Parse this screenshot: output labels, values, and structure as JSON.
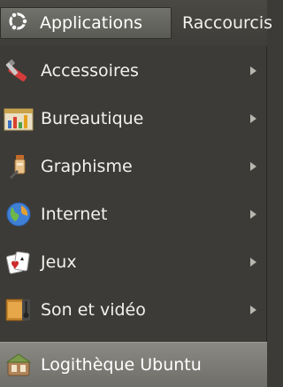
{
  "panel": {
    "applications_label": "Applications",
    "raccourcis_label": "Raccourcis",
    "ubuntu_logo_icon": "ubuntu-logo"
  },
  "menu": {
    "items": [
      {
        "label": "Accessoires",
        "icon": "accessories-icon",
        "has_submenu": true
      },
      {
        "label": "Bureautique",
        "icon": "office-icon",
        "has_submenu": true
      },
      {
        "label": "Graphisme",
        "icon": "graphics-icon",
        "has_submenu": true
      },
      {
        "label": "Internet",
        "icon": "internet-icon",
        "has_submenu": true
      },
      {
        "label": "Jeux",
        "icon": "games-icon",
        "has_submenu": true
      },
      {
        "label": "Son et vidéo",
        "icon": "multimedia-icon",
        "has_submenu": true
      },
      {
        "label": "Logithèque Ubuntu",
        "icon": "software-center-icon",
        "has_submenu": false,
        "highlighted": true
      }
    ]
  },
  "colors": {
    "panel_bg": "#3e3d39",
    "menu_bg": "#3c3b37",
    "highlight": "#7c7b76",
    "text": "#f2f1ed"
  }
}
